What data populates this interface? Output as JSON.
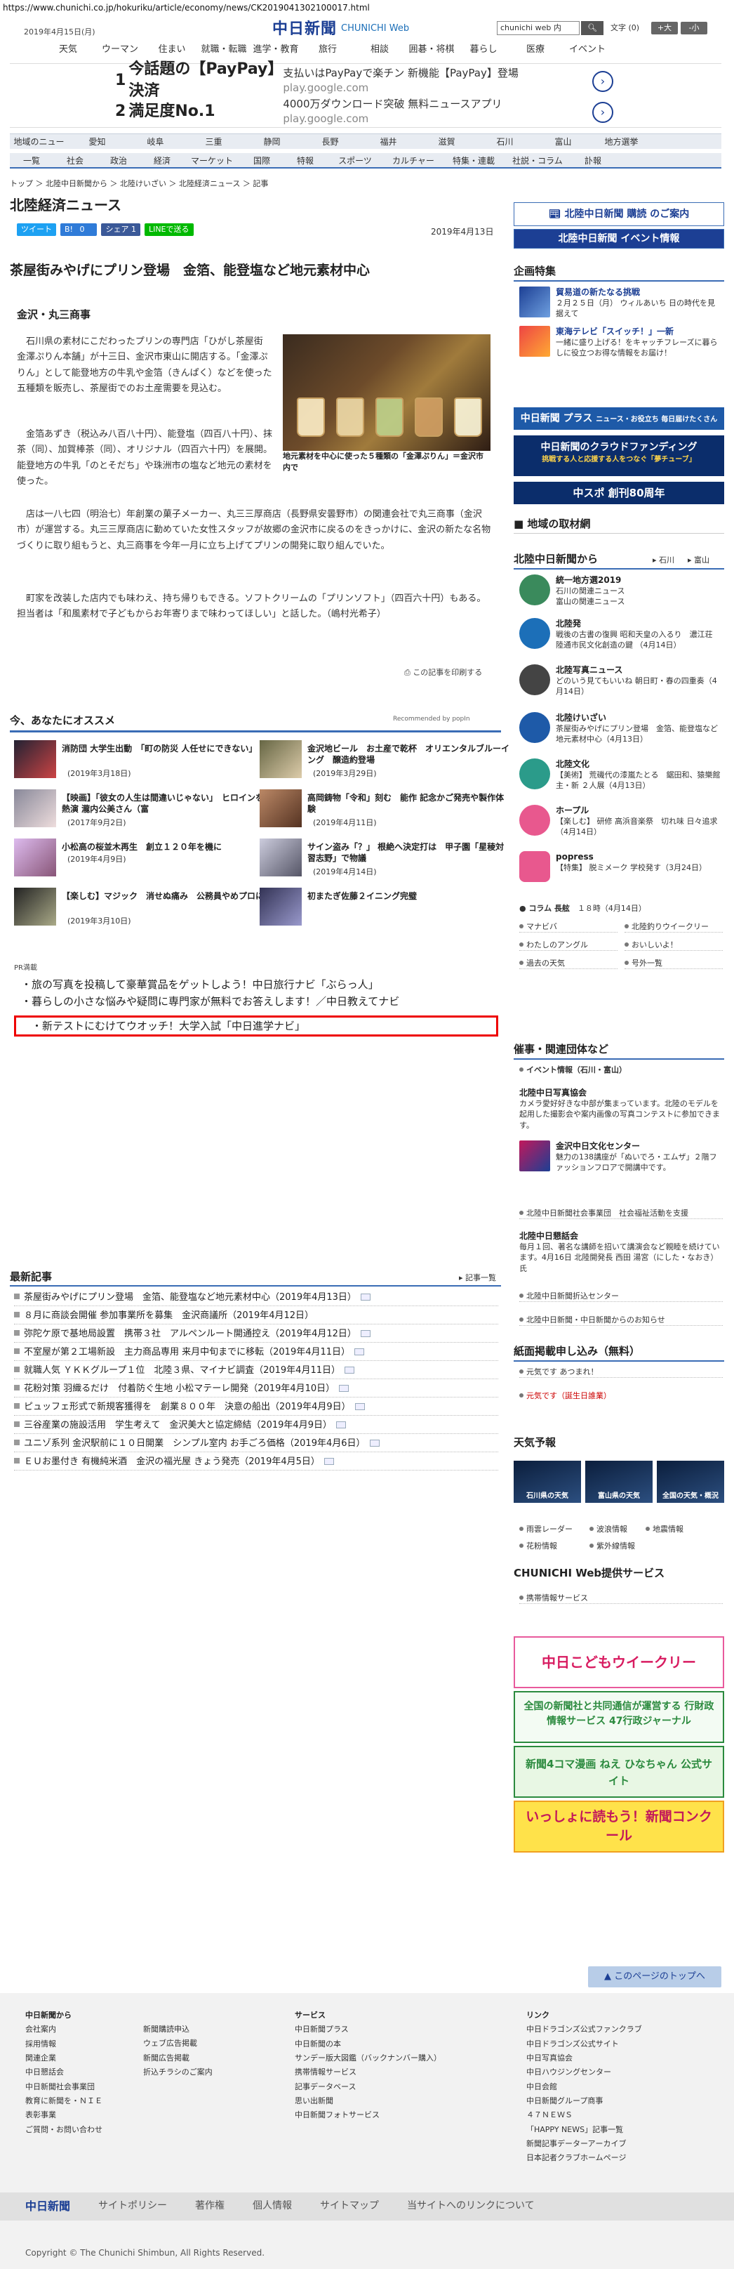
{
  "url": "https://www.chunichi.co.jp/hokuriku/article/economy/news/CK2019041302100017.html",
  "header": {
    "date": "2019年4月15日(月)",
    "logo_main": "中日新聞",
    "logo_sub": "CHUNICHI Web",
    "search_placeholder": "chunichi web 内",
    "search_button": "検索",
    "font_size_label": "文字",
    "font_size_value": "(0)",
    "font_larger": "+大",
    "font_smaller": "-小"
  },
  "top_nav": [
    "天気",
    "ウーマン",
    "住まい",
    "就職・転職",
    "進学・教育",
    "旅行",
    "相談",
    "囲碁・将棋",
    "暮らし",
    "医療",
    "イベント"
  ],
  "ads": [
    {
      "num": "1",
      "headline": "今話題の【PayPay】決済",
      "text": "支払いはPayPayで楽チン 新機能【PayPay】登場",
      "url": "play.google.com"
    },
    {
      "num": "2",
      "headline": "満足度No.1",
      "text": "4000万ダウンロード突破 無料ニュースアプリ",
      "url": "play.google.com"
    }
  ],
  "region_nav": [
    "地域のニュース",
    "愛知",
    "岐阜",
    "三重",
    "静岡",
    "長野",
    "福井",
    "滋賀",
    "石川",
    "富山",
    "地方選挙"
  ],
  "category_nav": [
    "一覧",
    "社会",
    "政治",
    "経済",
    "マーケット",
    "国際",
    "特報",
    "スポーツ",
    "カルチャー",
    "特集・連載",
    "社説・コラム",
    "訃報"
  ],
  "breadcrumb": "トップ ＞ 北陸中日新聞から ＞ 北陸けいざい ＞ 北陸経済ニュース ＞ 記事",
  "section_title": "北陸経済ニュース",
  "share": {
    "tweet": "ツイート",
    "bookmark": "0",
    "fb": "シェア 1",
    "line": "LINEで送る"
  },
  "article": {
    "date": "2019年4月13日",
    "title": "茶屋街みやげにプリン登場　金箔、能登塩など地元素材中心",
    "byline": "金沢・丸三商事",
    "photo_caption": "地元素材を中心に使った５種類の「金澤ぷりん」＝金沢市内で",
    "paragraphs": [
      "石川県の素材にこだわったプリンの専門店「ひがし茶屋街　金澤ぷりん本舗」が十三日、金沢市東山に開店する。「金澤ぷりん」として能登地方の牛乳や金箔（きんぱく）などを使った五種類を販売し、茶屋街でのお土産需要を見込む。",
      "金箔あずき（税込み八百八十円）、能登塩（四百八十円）、抹茶（同）、加賀棒茶（同）、オリジナル（四百六十円）を展開。能登地方の牛乳「のとそだち」や珠洲市の塩など地元の素材を使った。",
      "店は一八七四（明治七）年創業の菓子メーカー、丸三三厚商店（長野県安曇野市）の関連会社で丸三商事（金沢市）が運営する。丸三三厚商店に勤めていた女性スタッフが故郷の金沢市に戻るのをきっかけに、金沢の新たな名物づくりに取り組もうと、丸三商事を今年一月に立ち上げてプリンの開発に取り組んでいた。",
      "町家を改装した店内でも味わえ、持ち帰りもできる。ソフトクリームの「プリンソフト」（四百六十円）もある。担当者は「和風素材で子どもからお年寄りまで味わってほしい」と話した。（嶋村光希子）"
    ],
    "print_label": "この記事を印刷する"
  },
  "recommend": {
    "title": "今、あなたにオススメ",
    "by": "Recommended by popIn",
    "items": [
      {
        "title": "消防団 大学生出動　「町の防災 人任せにできない」",
        "date": "(2019年3月18日)"
      },
      {
        "title": "金沢地ビール　お土産で乾杯　オリエンタルブルーイング　醸造約登場",
        "date": "(2019年3月29日)"
      },
      {
        "title": "【映画】「彼女の人生は間違いじゃない」　ヒロインを熱演 瀧内公美さん（富",
        "date": "(2017年9月2日)"
      },
      {
        "title": "高岡鋳物「令和」刻む　能作 記念かご発売や製作体験",
        "date": "(2019年4月11日)"
      },
      {
        "title": "小松高の桜並木再生　創立１２０年を機に",
        "date": "(2019年4月9日)"
      },
      {
        "title": "サイン盗み「？」 根絶へ決定打は　甲子園「星稜対習志野」で物議",
        "date": "(2019年4月14日)"
      },
      {
        "title": "【楽しむ】マジック　消せぬ痛み　公務員やめプロに",
        "date": "(2019年3月10日)"
      },
      {
        "title": "初またぎ佐藤２イニング完璧",
        "date": ""
      }
    ]
  },
  "pr": {
    "label": "PR満載",
    "links": [
      "旅の写真を投稿して豪華賞品をゲットしよう！中日旅行ナビ「ぶらっ人」",
      "暮らしの小さな悩みや疑問に専門家が無料でお答えします！／中日教えてナビ",
      "新テストにむけてウオッチ！大学入試「中日進学ナビ」"
    ]
  },
  "latest": {
    "title": "最新記事",
    "more": "記事一覧",
    "items": [
      "茶屋街みやげにプリン登場　金箔、能登塩など地元素材中心（2019年4月13日）",
      "８月に商談会開催 参加事業所を募集　金沢商議所（2019年4月12日）",
      "弥陀ケ原で基地局設置　携帯３社　アルペンルート開通控え（2019年4月12日）",
      "不室屋が第２工場新設　主力商品専用 来月中旬までに移転（2019年4月11日）",
      "就職人気 ＹＫＫグループ１位　北陸３県、マイナビ調査（2019年4月11日）",
      "花粉対策 羽織るだけ　付着防ぐ生地 小松マテーレ開発（2019年4月10日）",
      "ピュッフェ形式で新規客獲得を　創業８００年　決意の船出（2019年4月9日）",
      "三谷産業の施設活用　学生考えて　金沢美大と協定締結（2019年4月9日）",
      "ユニゾ系列 金沢駅前に１０日開業　シンプル室内 お手ごろ価格（2019年4月6日）",
      "ＥＵお墨付き 有機純米酒　金沢の福光屋 きょう発売（2019年4月5日）"
    ]
  },
  "sidebar": {
    "subscribe": "北陸中日新聞 購読 のご案内",
    "event": "北陸中日新聞 イベント情報",
    "kikaku_title": "企画特集",
    "kikaku": [
      {
        "title": "貿易道の新たなる挑戦",
        "text": "２月２５日（月） ウィルあいち 日の時代を見据えて"
      },
      {
        "title": "東海テレビ「スイッチ！」一新",
        "text": "一緒に盛り上げる！をキャッチフレーズに暮らしに役立つお得な情報をお届け！"
      }
    ],
    "banner_plus": "中日新聞 プラス",
    "banner_plus_sub": "ニュース・お役立ち 毎日届けたくさん",
    "banner_cf": "中日新聞のクラウドファンディング",
    "banner_cf_sub": "挑戦する人と応援する人をつなぐ「夢チューブ」",
    "banner_chuspo": "中スポ 創刊80周年",
    "torizai": "地域の取材網",
    "hokuriku_title": "北陸中日新聞から",
    "hokuriku_tabs": [
      "石川",
      "富山"
    ],
    "hokuriku_items": [
      {
        "title": "統一地方選2019",
        "text": "石川の関連ニュース\n富山の関連ニュース"
      },
      {
        "title": "北陸発",
        "text": "戦後の古書の復興 昭和天皇の入るり　濃江荘 陸通市民文化創造の鍵 （4月14日）"
      },
      {
        "title": "北陸写真ニュース",
        "text": "どのいう見てもいいね 朝日町・春の四重奏（4月14日）"
      },
      {
        "title": "北陸けいざい",
        "text": "茶屋街みやげにプリン登場　金箔、能登塩など地元素材中心（4月13日）"
      },
      {
        "title": "北陸文化",
        "text": "【美術】 荒磯代の漆嵐たとる　鋸田和、猿樂館主・新 ２人展（4月13日）"
      },
      {
        "title": "ホープル",
        "text": "【楽しむ】 研修 高浜音楽祭　切れ味 日々追求（4月14日）"
      },
      {
        "title": "popress",
        "text": "【特集】 脱ミメーク 学校発す（3月24日）"
      }
    ],
    "column_label": "コラム 長舷",
    "column_date": "１８時（4月14日）",
    "links_grid": [
      "マナビバ",
      "北陸釣りウイークリー",
      "わたしのアングル",
      "おいしいよ！",
      "過去の天気",
      "号外一覧"
    ],
    "jigyo_title": "催事・関連団体など",
    "jigyo_link": "イベント情報（石川・富山）",
    "jigyo_items": [
      {
        "title": "北陸中日写真協会",
        "text": "カメラ愛好好きな中部が集まっています。北陸のモデルを起用した撮影会や案内画像の写真コンテストに参加できます。"
      },
      {
        "title": "金沢中日文化センター",
        "text": "魅力の138講座が「ぬいでろ・エムザ」２階ファッションフロアで開講中です。"
      }
    ],
    "jigyo_links": [
      "北陸中日新聞社会事業団　社会福祉活動を支援",
      "北陸中日新聞・中日新聞からのお知らせ"
    ],
    "jigyo_item3": {
      "title": "北陸中日懇話会",
      "text": "毎月１回、著名な講師を招いて講演会など親睦を続けています。4月16日 北陸開発長 西田 湯宮（にした・なおき）氏"
    },
    "jigyo_link3": "北陸中日新聞折込センター",
    "kamen_title": "紙面掲載申し込み（無料）",
    "kamen_links": [
      "元気です あつまれ！",
      "元気です（誕生日誰業）"
    ],
    "weather_title": "天気予報",
    "weather_tiles": [
      "石川県の天気",
      "富山県の天気",
      "全国の天気・概況"
    ],
    "weather_links": [
      "雨雲レーダー",
      "波浪情報",
      "地震情報",
      "花粉情報",
      "紫外線情報"
    ],
    "service_title": "CHUNICHI Web提供サービス",
    "service_link": "携帯情報サービス",
    "bb1": "中日こどもウイークリー",
    "bb2": "全国の新聞社と共同通信が運営する 行財政情報サービス 47行政ジャーナル",
    "bb3": "新聞4コマ漫画 ねえ ひなちゃん 公式サイト",
    "bb4": "いっしょに読もう！新聞コンクール"
  },
  "pagetop": "このページのトップへ",
  "footer": {
    "col1_title": "中日新聞から",
    "col1": [
      "会社案内",
      "採用情報",
      "関連企業",
      "中日懇話会",
      "中日新聞社会事業団",
      "教育に新聞を・ＮＩＥ",
      "表彰事業",
      "ご質問・お問い合わせ"
    ],
    "col2": [
      "新聞購読申込",
      "ウェブ広告掲載",
      "新聞広告掲載",
      "折込チラシのご案内"
    ],
    "col3_title": "サービス",
    "col3": [
      "中日新聞プラス",
      "中日新聞の本",
      "サンデー版大図鑑（バックナンバー購入）",
      "携帯情報サービス",
      "記事データベース",
      "思い出新聞",
      "中日新聞フォトサービス"
    ],
    "col4_title": "リンク",
    "col4": [
      "中日ドラゴンズ公式ファンクラブ",
      "中日ドラゴンズ公式サイト",
      "中日写真協会",
      "中日ハウジングセンター",
      "中日会館",
      "中日新聞グループ商事",
      "４７ＮＥＷＳ",
      "「HAPPY NEWS」記事一覧",
      "新聞記事データーアーカイブ",
      "日本記者クラブホームページ"
    ],
    "bar_logo": "中日新聞",
    "bar_links": [
      "サイトポリシー",
      "著作権",
      "個人情報",
      "サイトマップ",
      "当サイトへのリンクについて"
    ],
    "copyright": "Copyright © The Chunichi Shimbun, All Rights Reserved."
  },
  "colors": {
    "brand": "#1c3f94",
    "accent": "#3a6cb5",
    "highlight_border": "#ee0000"
  }
}
